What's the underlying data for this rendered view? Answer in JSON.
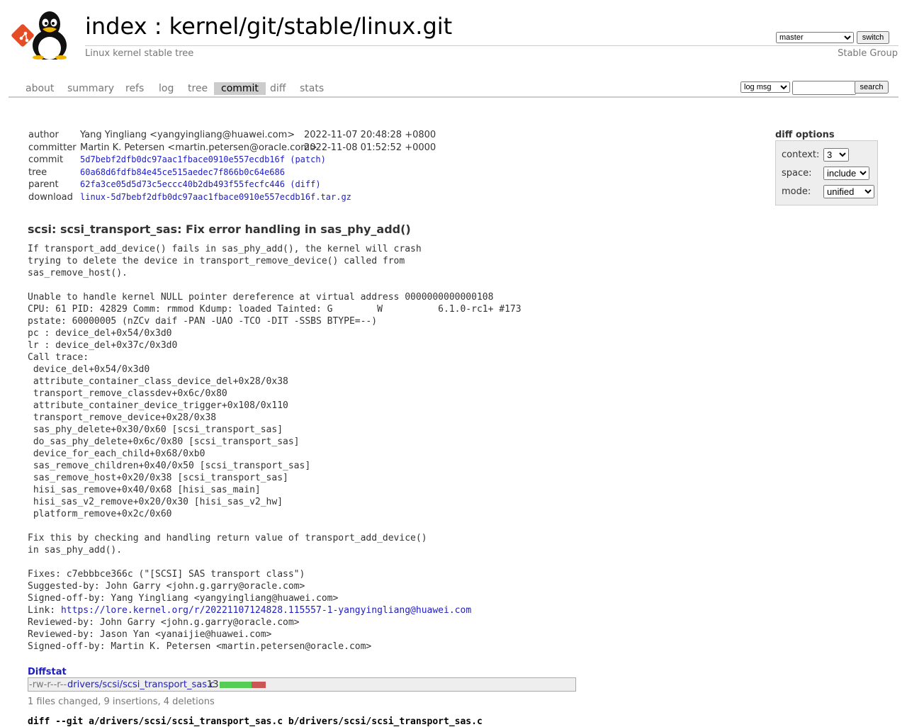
{
  "header": {
    "title": "index : kernel/git/stable/linux.git",
    "subtitle": "Linux kernel stable tree",
    "owner": "Stable Group",
    "branch": "master",
    "switch_label": "switch"
  },
  "tabs": [
    {
      "label": "about",
      "active": false
    },
    {
      "label": "summary",
      "active": false
    },
    {
      "label": "refs",
      "active": false
    },
    {
      "label": "log",
      "active": false
    },
    {
      "label": "tree",
      "active": false
    },
    {
      "label": "commit",
      "active": true
    },
    {
      "label": "diff",
      "active": false
    },
    {
      "label": "stats",
      "active": false
    }
  ],
  "search": {
    "mode": "log msg",
    "query": "",
    "button": "search"
  },
  "commit_info": {
    "author_key": "author",
    "author": "Yang Yingliang <yangyingliang@huawei.com>",
    "author_date": "2022-11-07 20:48:28 +0800",
    "committer_key": "committer",
    "committer": "Martin K. Petersen <martin.petersen@oracle.com>",
    "committer_date": "2022-11-08 01:52:52 +0000",
    "commit_key": "commit",
    "commit": "5d7bebf2dfb0dc97aac1fbace0910e557ecdb16f",
    "commit_extra": "(patch)",
    "tree_key": "tree",
    "tree": "60a68d6fdfb84e45ce515aedec7f866b0c64e686",
    "parent_key": "parent",
    "parent": "62fa3ce05d5d73c5eccc40b2db493f55fecfc446",
    "parent_extra": "(diff)",
    "download_key": "download",
    "download": "linux-5d7bebf2dfb0dc97aac1fbace0910e557ecdb16f.tar.gz"
  },
  "diff_options": {
    "title": "diff options",
    "context_label": "context:",
    "context_value": "3",
    "space_label": "space:",
    "space_value": "include",
    "mode_label": "mode:",
    "mode_value": "unified"
  },
  "subject": "scsi: scsi_transport_sas: Fix error handling in sas_phy_add()",
  "message": {
    "before_link": "If transport_add_device() fails in sas_phy_add(), the kernel will crash\ntrying to delete the device in transport_remove_device() called from\nsas_remove_host().\n\nUnable to handle kernel NULL pointer dereference at virtual address 0000000000000108\nCPU: 61 PID: 42829 Comm: rmmod Kdump: loaded Tainted: G        W          6.1.0-rc1+ #173\npstate: 60000005 (nZCv daif -PAN -UAO -TCO -DIT -SSBS BTYPE=--)\npc : device_del+0x54/0x3d0\nlr : device_del+0x37c/0x3d0\nCall trace:\n device_del+0x54/0x3d0\n attribute_container_class_device_del+0x28/0x38\n transport_remove_classdev+0x6c/0x80\n attribute_container_device_trigger+0x108/0x110\n transport_remove_device+0x28/0x38\n sas_phy_delete+0x30/0x60 [scsi_transport_sas]\n do_sas_phy_delete+0x6c/0x80 [scsi_transport_sas]\n device_for_each_child+0x68/0xb0\n sas_remove_children+0x40/0x50 [scsi_transport_sas]\n sas_remove_host+0x20/0x38 [scsi_transport_sas]\n hisi_sas_remove+0x40/0x68 [hisi_sas_main]\n hisi_sas_v2_remove+0x20/0x30 [hisi_sas_v2_hw]\n platform_remove+0x2c/0x60\n\nFix this by checking and handling return value of transport_add_device()\nin sas_phy_add().\n\nFixes: c7ebbbce366c (\"[SCSI] SAS transport class\")\nSuggested-by: John Garry <john.g.garry@oracle.com>\nSigned-off-by: Yang Yingliang <yangyingliang@huawei.com>\nLink: ",
    "link": "https://lore.kernel.org/r/20221107124828.115557-1-yangyingliang@huawei.com",
    "after_link": "\nReviewed-by: John Garry <john.g.garry@oracle.com>\nReviewed-by: Jason Yan <yanaijie@huawei.com>\nSigned-off-by: Martin K. Petersen <martin.petersen@oracle.com>"
  },
  "diffstat": {
    "header": "Diffstat",
    "mode": "-rw-r--r--",
    "file": "drivers/scsi/scsi_transport_sas.c",
    "changes": "13",
    "insertions": 9,
    "deletions": 4,
    "add_color": "#55cc55",
    "del_color": "#cc5555",
    "summary": "1 files changed, 9 insertions, 4 deletions"
  },
  "diff_header": "diff --git a/drivers/scsi/scsi_transport_sas.c b/drivers/scsi/scsi_transport_sas.c"
}
